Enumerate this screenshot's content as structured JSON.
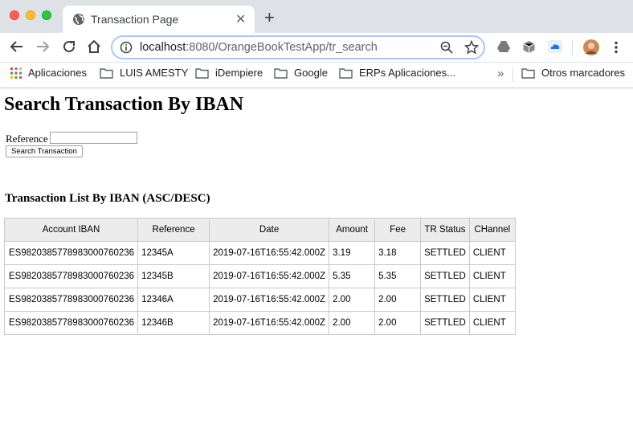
{
  "browser": {
    "tab_title": "Transaction Page",
    "url_host": "localhost",
    "url_rest": ":8080/OrangeBookTestApp/tr_search",
    "bookmarks": [
      {
        "label": "Aplicaciones",
        "icon": "apps-grid-icon"
      },
      {
        "label": "LUIS AMESTY",
        "icon": "folder-icon"
      },
      {
        "label": "iDempiere",
        "icon": "folder-icon"
      },
      {
        "label": "Google",
        "icon": "folder-icon"
      },
      {
        "label": "ERPs Aplicaciones...",
        "icon": "folder-icon"
      }
    ],
    "other_bookmarks": "Otros marcadores"
  },
  "page": {
    "heading": "Search Transaction By IBAN",
    "reference_label": "Reference",
    "reference_value": "",
    "search_button": "Search Transaction",
    "list_heading": "Transaction List By IBAN (ASC/DESC)",
    "table": {
      "headers": [
        "Account IBAN",
        "Reference",
        "Date",
        "Amount",
        "Fee",
        "TR Status",
        "CHannel"
      ],
      "rows": [
        [
          "ES9820385778983000760236",
          "12345A",
          "2019-07-16T16:55:42.000Z",
          "3.19",
          "3.18",
          "SETTLED",
          "CLIENT"
        ],
        [
          "ES9820385778983000760236",
          "12345B",
          "2019-07-16T16:55:42.000Z",
          "5.35",
          "5.35",
          "SETTLED",
          "CLIENT"
        ],
        [
          "ES9820385778983000760236",
          "12346A",
          "2019-07-16T16:55:42.000Z",
          "2.00",
          "2.00",
          "SETTLED",
          "CLIENT"
        ],
        [
          "ES9820385778983000760236",
          "12346B",
          "2019-07-16T16:55:42.000Z",
          "2.00",
          "2.00",
          "SETTLED",
          "CLIENT"
        ]
      ]
    }
  }
}
